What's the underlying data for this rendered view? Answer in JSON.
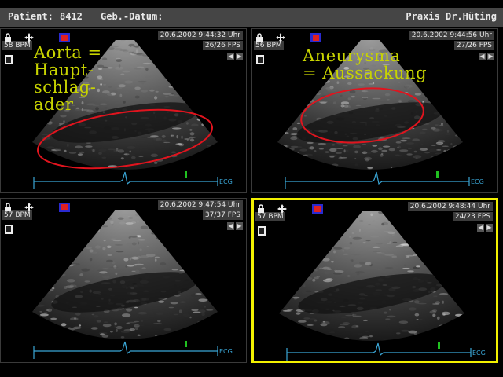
{
  "header": {
    "patient_label": "Patient:",
    "patient_id": "8412",
    "dob_label": "Geb.-Datum:",
    "practice": "Praxis Dr.Hüting"
  },
  "panels": [
    {
      "timestamp": "20.6.2002 9:44:32 Uhr",
      "fps": "26/26 FPS",
      "bpm": "58 BPM",
      "ecg_label": "ECG",
      "annotation_lines": [
        "Aorta =",
        "Haupt-",
        "schlag-",
        "ader"
      ],
      "active": false
    },
    {
      "timestamp": "20.6.2002 9:44:56 Uhr",
      "fps": "27/26 FPS",
      "bpm": "56 BPM",
      "ecg_label": "ECG",
      "annotation_lines": [
        "Aneurysma",
        "= Aussackung"
      ],
      "active": false
    },
    {
      "timestamp": "20.6.2002 9:47:54 Uhr",
      "fps": "37/37 FPS",
      "bpm": "57 BPM",
      "ecg_label": "ECG",
      "active": false
    },
    {
      "timestamp": "20.6.2002 9:48:44 Uhr",
      "fps": "24/23 FPS",
      "bpm": "57 BPM",
      "ecg_label": "ECG",
      "active": true
    }
  ],
  "colors": {
    "annotation": "#c8d400",
    "ellipse": "#e0141e",
    "active_border": "#f2f000",
    "ecg": "#3aa6d6"
  },
  "icons": [
    "lock-icon",
    "move-icon",
    "color-doppler-icon",
    "printer-icon",
    "arrow-left-icon",
    "arrow-right-icon"
  ]
}
